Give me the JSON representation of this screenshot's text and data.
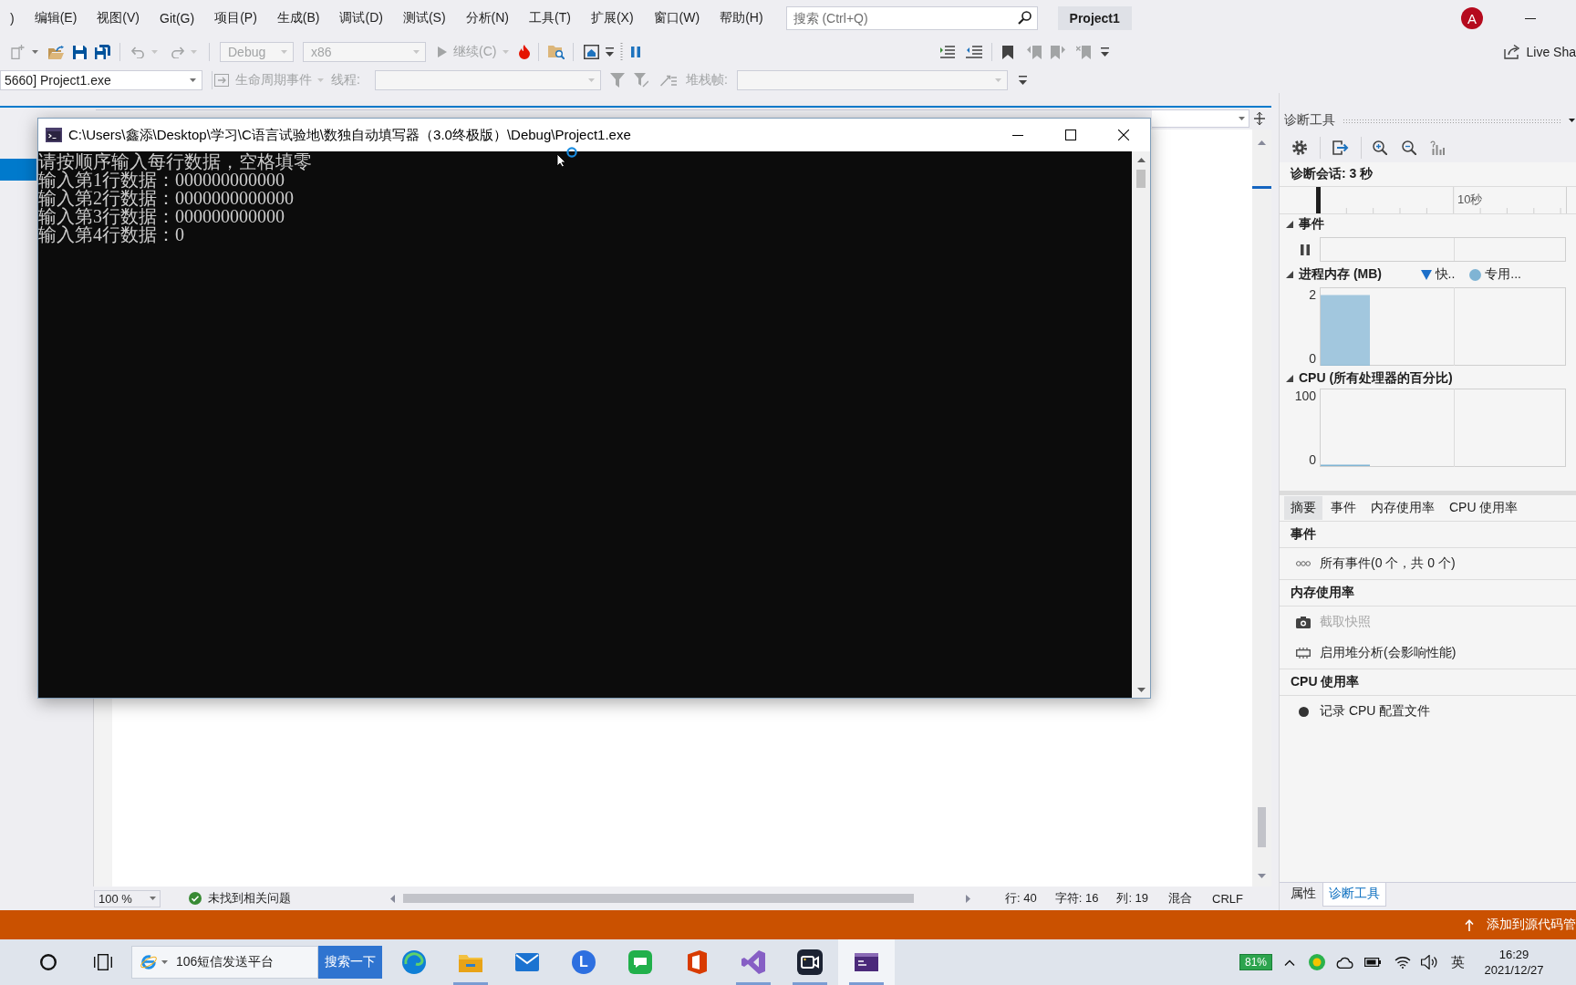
{
  "menu_bar": {
    "items": [
      ")",
      "编辑(E)",
      "视图(V)",
      "Git(G)",
      "项目(P)",
      "生成(B)",
      "调试(D)",
      "测试(S)",
      "分析(N)",
      "工具(T)",
      "扩展(X)",
      "窗口(W)",
      "帮助(H)"
    ],
    "search": {
      "placeholder": "搜索 (Ctrl+Q)"
    },
    "solution_name": "Project1",
    "avatar_initial": "A"
  },
  "toolbar": {
    "configuration": {
      "value": "Debug",
      "disabled": true
    },
    "platform": {
      "value": "x86",
      "disabled": true
    },
    "continue": {
      "label": "继续(C)",
      "disabled": true
    },
    "live_share": "Live Sha"
  },
  "debug_location": {
    "process": "5660] Project1.exe",
    "lifecycle_events": {
      "label": "生命周期事件",
      "disabled": true
    },
    "thread": {
      "label": "线程:",
      "disabled": true
    },
    "stack_frame": {
      "label": "堆栈帧:",
      "disabled": true
    }
  },
  "console_window": {
    "title": "C:\\Users\\鑫添\\Desktop\\学习\\C语言试验地\\数独自动填写器（3.0终极版）\\Debug\\Project1.exe",
    "lines": [
      "请按顺序输入每行数据，空格填零",
      "输入第1行数据：000000000000",
      "输入第2行数据：0000000000000",
      "输入第3行数据：000000000000",
      "输入第4行数据：0"
    ]
  },
  "editor_status": {
    "zoom": "100 %",
    "issues": "未找到相关问题",
    "line": "行: 40",
    "character": "字符: 16",
    "column": "列: 19",
    "whitespace": "混合",
    "line_ending": "CRLF"
  },
  "diagnostics": {
    "title": "诊断工具",
    "session": "诊断会话: 3 秒",
    "ruler_label": "10秒",
    "events": {
      "title": "事件",
      "expanded": true
    },
    "memory": {
      "title": "进程内存 (MB)",
      "expanded": true,
      "legend": [
        {
          "label": "快..",
          "kind": "triangle",
          "color": "#1c6fc9"
        },
        {
          "label": "专用...",
          "kind": "dot",
          "color": "#7fb4d4"
        }
      ],
      "axis_labels": [
        "2",
        "0"
      ]
    },
    "cpu": {
      "title": "CPU (所有处理器的百分比)",
      "expanded": true,
      "axis_labels": [
        "100",
        "0"
      ]
    },
    "tabs": [
      {
        "label": "摘要",
        "selected": true
      },
      {
        "label": "事件",
        "selected": false
      },
      {
        "label": "内存使用率",
        "selected": false
      },
      {
        "label": "CPU 使用率",
        "selected": false
      }
    ],
    "sections": [
      {
        "title": "事件",
        "items": [
          {
            "kind": "events",
            "label": "所有事件(0 个，共 0 个)",
            "disabled": false
          }
        ]
      },
      {
        "title": "内存使用率",
        "items": [
          {
            "kind": "snapshot",
            "label": "截取快照",
            "disabled": true
          },
          {
            "kind": "heap",
            "label": "启用堆分析(会影响性能)",
            "disabled": false
          }
        ]
      },
      {
        "title": "CPU 使用率",
        "items": [
          {
            "kind": "record",
            "label": "记录 CPU 配置文件",
            "disabled": false
          }
        ]
      }
    ]
  },
  "panel_tabs": [
    {
      "label": "属性",
      "selected": false
    },
    {
      "label": "诊断工具",
      "selected": true
    }
  ],
  "status_bar": {
    "source_control": "添加到源代码管"
  },
  "taskbar": {
    "search": {
      "value": "106短信发送平台",
      "button": "搜索一下"
    },
    "apps": [
      {
        "kind": "browser",
        "running": false,
        "selected": false
      },
      {
        "kind": "folder",
        "running": true,
        "selected": false
      },
      {
        "kind": "mail",
        "running": false,
        "selected": false
      },
      {
        "kind": "letter",
        "letter": "L",
        "running": false,
        "selected": false
      },
      {
        "kind": "chat",
        "running": false,
        "selected": false
      },
      {
        "kind": "office",
        "running": false,
        "selected": false
      },
      {
        "kind": "ide",
        "running": true,
        "selected": false
      },
      {
        "kind": "camera",
        "running": true,
        "selected": false
      },
      {
        "kind": "console",
        "running": true,
        "selected": true
      }
    ],
    "tray_badge": "81%",
    "input_method": "英",
    "time": "16:29",
    "date": "2021/12/27"
  }
}
